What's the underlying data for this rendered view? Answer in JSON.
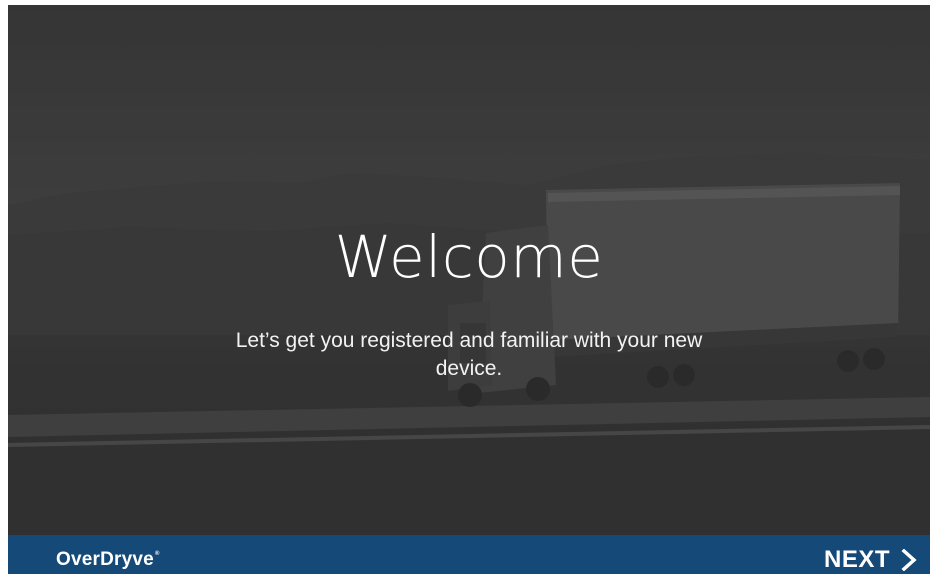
{
  "hero": {
    "title": "Welcome",
    "subtitle": "Let’s get you registered and familiar with your new device.",
    "background_image": "truck-on-highway-photo"
  },
  "footer": {
    "brand_name": "OverDryve",
    "brand_mark": "®",
    "next_label": "NEXT",
    "next_icon": "chevron-right-icon"
  },
  "colors": {
    "footer_background": "#154a78",
    "overlay": "#3a3a3a",
    "text": "#ffffff"
  }
}
